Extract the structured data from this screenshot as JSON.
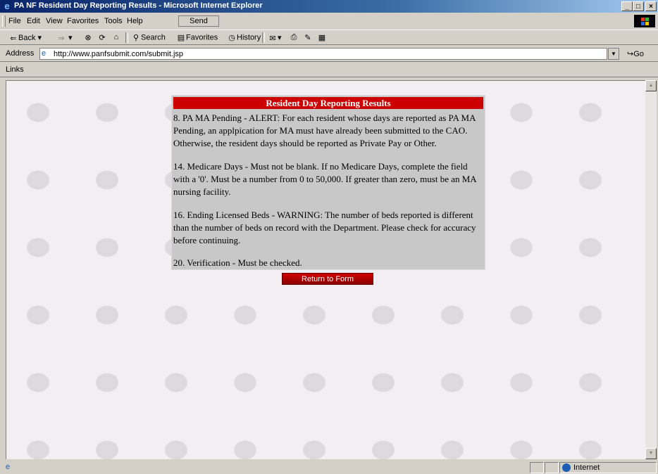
{
  "window": {
    "title": "PA NF Resident Day Reporting Results - Microsoft Internet Explorer",
    "controls": [
      "_",
      "□",
      "×"
    ]
  },
  "menu": {
    "items": [
      "File",
      "Edit",
      "View",
      "Favorites",
      "Tools",
      "Help"
    ],
    "send_label": "Send"
  },
  "toolbar": {
    "back": "Back",
    "search": "Search",
    "favorites": "Favorites",
    "history": "History"
  },
  "address": {
    "label": "Address",
    "url": "http://www.panfsubmit.com/submit.jsp",
    "go": "Go"
  },
  "links": {
    "label": "Links"
  },
  "results": {
    "header": "Resident Day Reporting Results",
    "messages": [
      "8. PA MA Pending - ALERT: For each resident whose days are reported as PA MA Pending, an applpication for MA must have already been submitted to the CAO. Otherwise, the resident days should be reported as Private Pay or Other.",
      "14. Medicare Days - Must not be blank. If no Medicare Days, complete the field with a '0'. Must be a number from 0 to 50,000. If greater than zero, must be an MA nursing facility.",
      "16. Ending Licensed Beds - WARNING: The number of beds reported is different than the number of beds on record with the Department. Please check for accuracy before continuing.",
      "20. Verification - Must be checked."
    ],
    "return_label": "Return to Form"
  },
  "status": {
    "zone": "Internet"
  },
  "colors": {
    "header_bg": "#cc0000",
    "box_bg": "#c8c8c8",
    "page_bg": "#f2eef1"
  }
}
